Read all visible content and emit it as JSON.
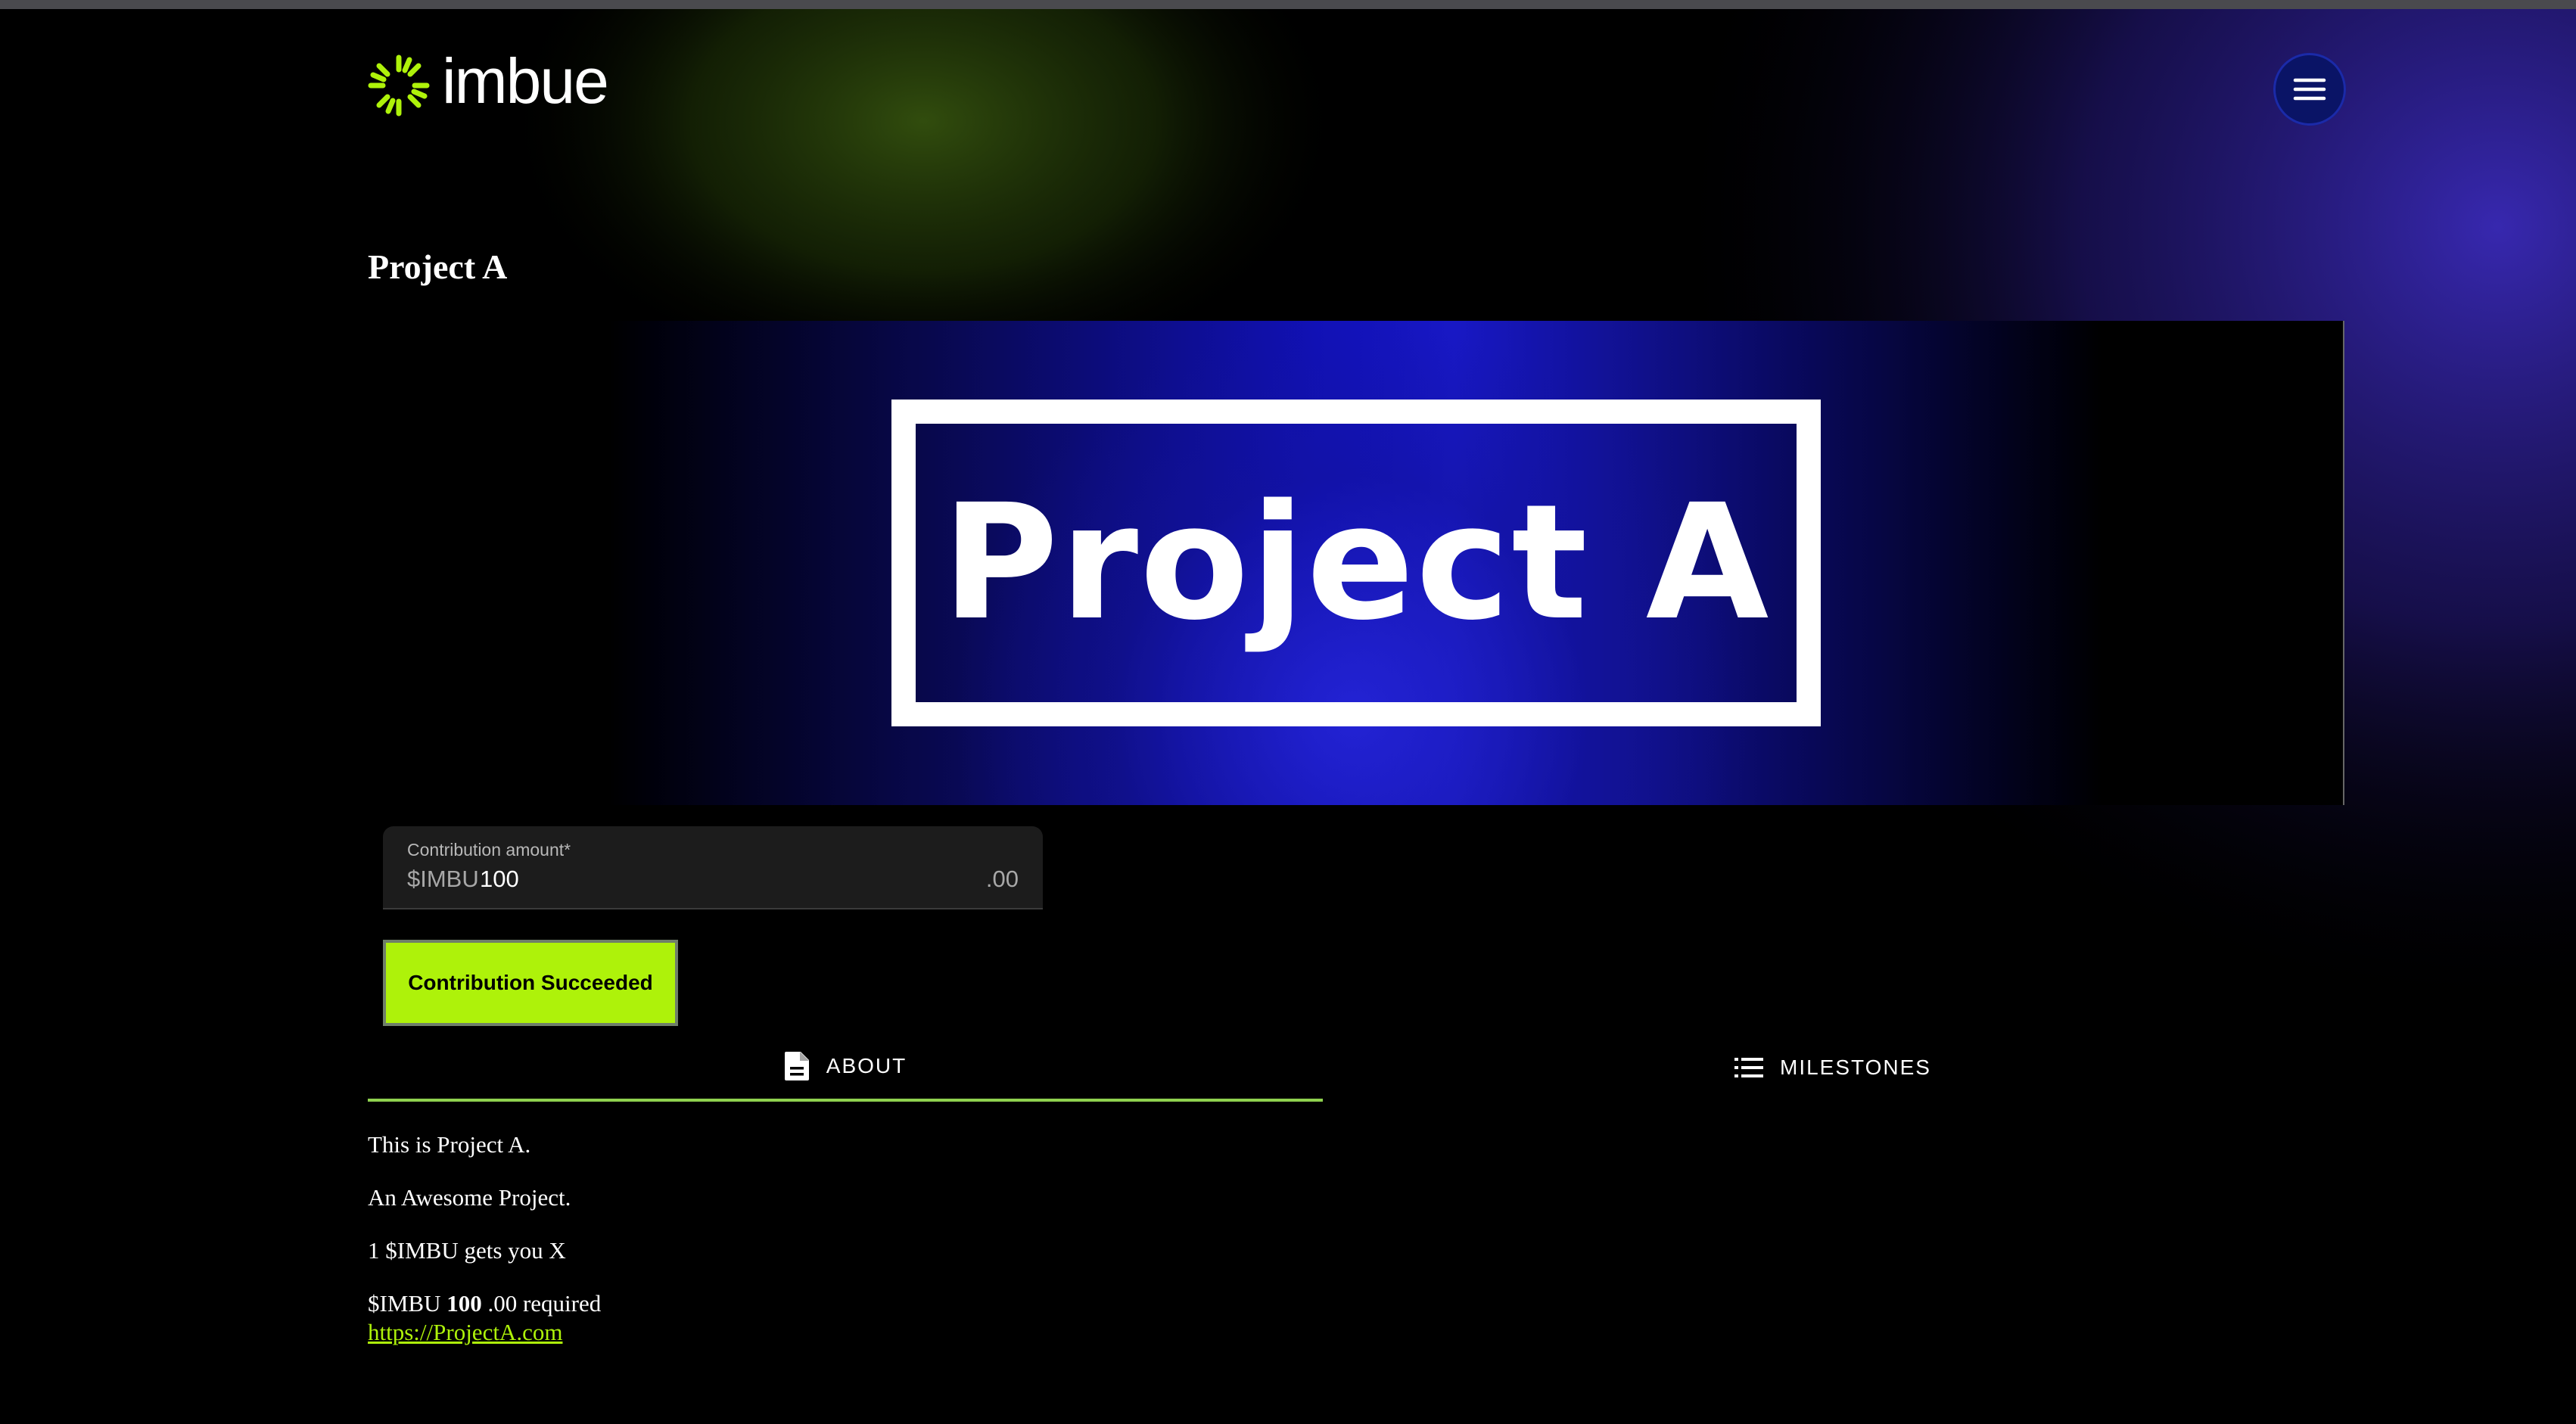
{
  "brand": {
    "name": "imbue",
    "accent": "#aef20a"
  },
  "header": {
    "menu_icon": "hamburger-icon"
  },
  "project": {
    "title": "Project A",
    "banner_text": "Project A"
  },
  "contribution": {
    "label": "Contribution amount*",
    "currency_prefix": "$IMBU",
    "value": "100",
    "suffix": ".00",
    "status_button": "Contribution Succeeded"
  },
  "tabs": [
    {
      "label": "ABOUT",
      "icon": "document-icon",
      "active": true
    },
    {
      "label": "MILESTONES",
      "icon": "list-icon",
      "active": false
    }
  ],
  "about": {
    "lines": [
      "This is Project A.",
      "An Awesome Project.",
      "1 $IMBU gets you X"
    ],
    "required_prefix": "$IMBU",
    "required_amount": "100",
    "required_suffix": ".00 required",
    "link": "https://ProjectA.com"
  }
}
